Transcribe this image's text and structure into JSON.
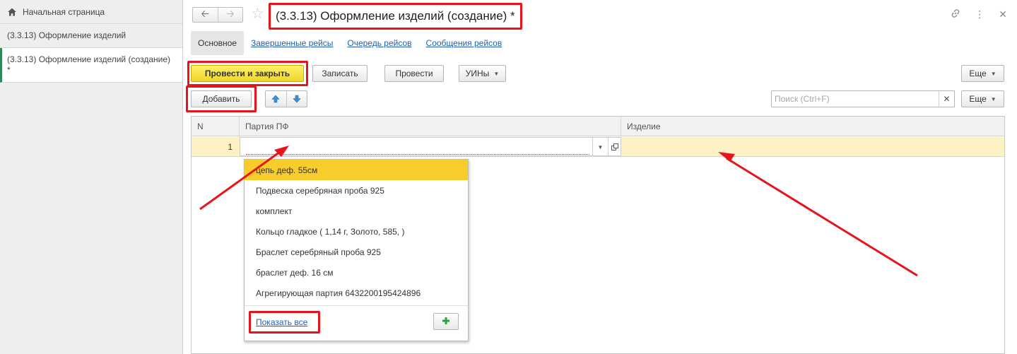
{
  "sidebar": {
    "home_label": "Начальная страница",
    "items": [
      {
        "label": "(3.3.13) Оформление изделий"
      },
      {
        "label": "(3.3.13) Оформление изделий (создание) *"
      }
    ]
  },
  "header": {
    "title": "(3.3.13) Оформление изделий (создание) *"
  },
  "tabs": [
    {
      "label": "Основное"
    },
    {
      "label": "Завершенные рейсы"
    },
    {
      "label": "Очередь рейсов"
    },
    {
      "label": "Сообщения рейсов"
    }
  ],
  "toolbar": {
    "post_close_label": "Провести и закрыть",
    "save_label": "Записать",
    "post_label": "Провести",
    "uins_label": "УИНы",
    "more_label": "Еще"
  },
  "table_toolbar": {
    "add_label": "Добавить",
    "search_placeholder": "Поиск (Ctrl+F)",
    "more_label": "Еще"
  },
  "table": {
    "columns": [
      "N",
      "Партия ПФ",
      "Изделие"
    ],
    "rows": [
      {
        "n": "1",
        "batch": "",
        "product": ""
      }
    ]
  },
  "dropdown": {
    "items": [
      "цепь деф. 55см",
      "Подвеска серебряная проба 925",
      "комплект",
      "Кольцо  гладкое ( 1,14 г, Золото, 585, )",
      "Браслет серебряный проба 925",
      "браслет деф. 16 см",
      "Агрегирующая партия 6432200195424896"
    ],
    "selected_index": 0,
    "show_all_label": "Показать все"
  },
  "colors": {
    "accent_yellow": "#f8cd2b",
    "annotation_red": "#e8141b",
    "link_blue": "#1e5fb4",
    "active_nav_green": "#2e8b57"
  }
}
